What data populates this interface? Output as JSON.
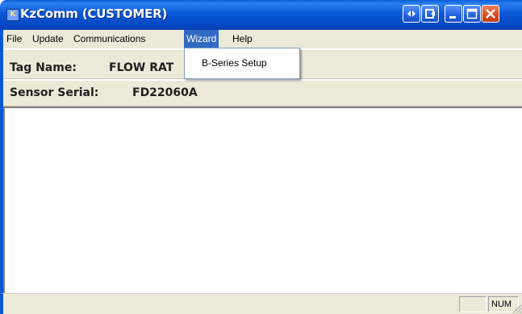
{
  "window": {
    "title": "KzComm (CUSTOMER)",
    "icon": "kz-app-icon",
    "controls": [
      "swap-icon",
      "exit-icon",
      "minimize-icon",
      "maximize-icon",
      "close-icon"
    ]
  },
  "menu": {
    "items": [
      "File",
      "Update",
      "Communications",
      "Wizard",
      "Help"
    ],
    "active": "Wizard",
    "dropdown": {
      "items": [
        "B-Series Setup"
      ]
    }
  },
  "info": {
    "tag_label": "Tag Name:",
    "tag_value": "FLOW RAT",
    "serial_label": "Sensor Serial:",
    "serial_value": "FD22060A"
  },
  "status": {
    "panels": [
      "",
      "NUM"
    ]
  },
  "colors": {
    "titlebar": "#0a57d6",
    "menu_highlight": "#316ac5",
    "chrome": "#ece9d8",
    "close_button": "#d8471c"
  }
}
